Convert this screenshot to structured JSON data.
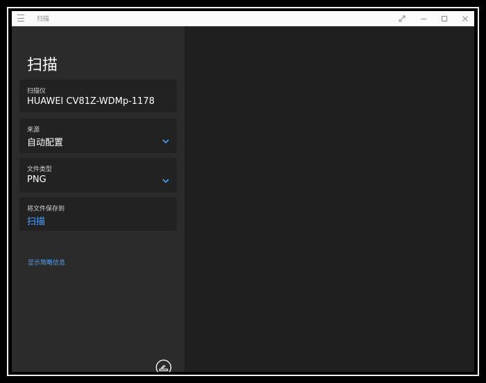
{
  "window": {
    "title": "扫描"
  },
  "page": {
    "title": "扫描"
  },
  "fields": {
    "scanner": {
      "label": "扫描仪",
      "value": "HUAWEI CV81Z-WDMp-1178"
    },
    "source": {
      "label": "来源",
      "value": "自动配置"
    },
    "file_type": {
      "label": "文件类型",
      "value": "PNG"
    },
    "save_to": {
      "label": "将文件保存到",
      "value": "扫描"
    }
  },
  "links": {
    "show_less": "显示简略信息"
  },
  "actions": {
    "scan_label": "扫描"
  },
  "colors": {
    "accent": "#4aa3ff",
    "left_pane": "#2b2b2b",
    "right_pane": "#1f1f1f",
    "card": "#222222"
  },
  "icons": {
    "menu": "hamburger-icon",
    "fullscreen": "expand-icon",
    "minimize": "minimize-icon",
    "maximize": "maximize-icon",
    "close": "close-icon",
    "dropdown": "chevron-down-icon",
    "scan": "scanner-icon"
  }
}
